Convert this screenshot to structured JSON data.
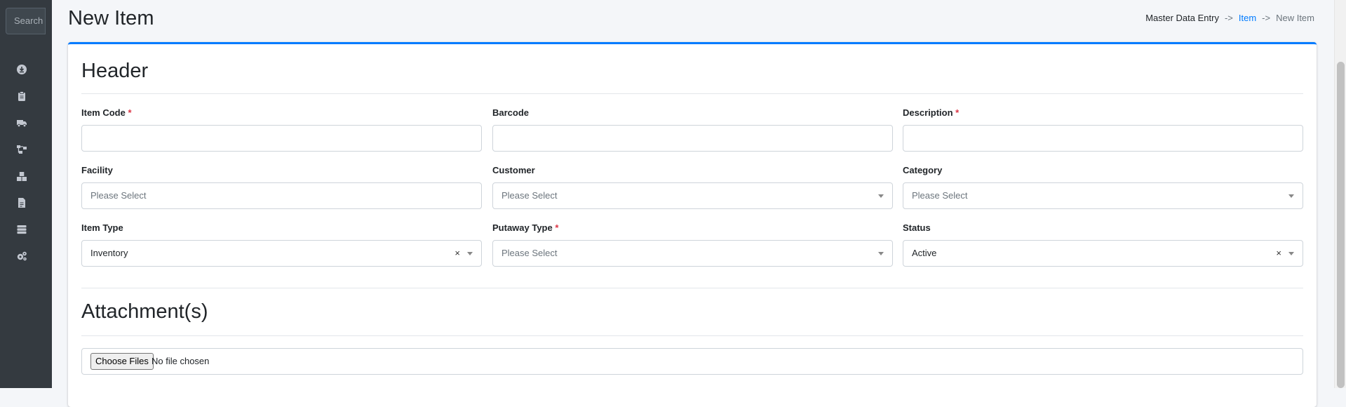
{
  "sidebar": {
    "search_placeholder": "Search",
    "icons": [
      "download-circle-icon",
      "clipboard-icon",
      "truck-icon",
      "network-icon",
      "boxes-icon",
      "file-icon",
      "database-icon",
      "cogs-icon"
    ]
  },
  "header": {
    "title": "New Item",
    "breadcrumb": [
      "Master Data Entry",
      "->",
      "Item",
      "->",
      "New Item"
    ]
  },
  "form": {
    "header_section": "Header",
    "fields": {
      "item_code": {
        "label": "Item Code",
        "required": "*",
        "value": ""
      },
      "barcode": {
        "label": "Barcode",
        "value": ""
      },
      "description": {
        "label": "Description",
        "required": "*",
        "value": ""
      },
      "facility": {
        "label": "Facility",
        "placeholder": "Please Select"
      },
      "customer": {
        "label": "Customer",
        "placeholder": "Please Select"
      },
      "category": {
        "label": "Category",
        "placeholder": "Please Select"
      },
      "item_type": {
        "label": "Item Type",
        "value": "Inventory",
        "clear": "×"
      },
      "putaway_type": {
        "label": "Putaway Type",
        "required": "*",
        "placeholder": "Please Select"
      },
      "status": {
        "label": "Status",
        "value": "Active",
        "clear": "×"
      }
    },
    "attachments_section": "Attachment(s)",
    "file": {
      "button_label": "Choose Files",
      "status": "No file chosen"
    }
  },
  "colors": {
    "accent": "#007bff",
    "sidebar": "#343a40",
    "required": "#dc3545"
  }
}
